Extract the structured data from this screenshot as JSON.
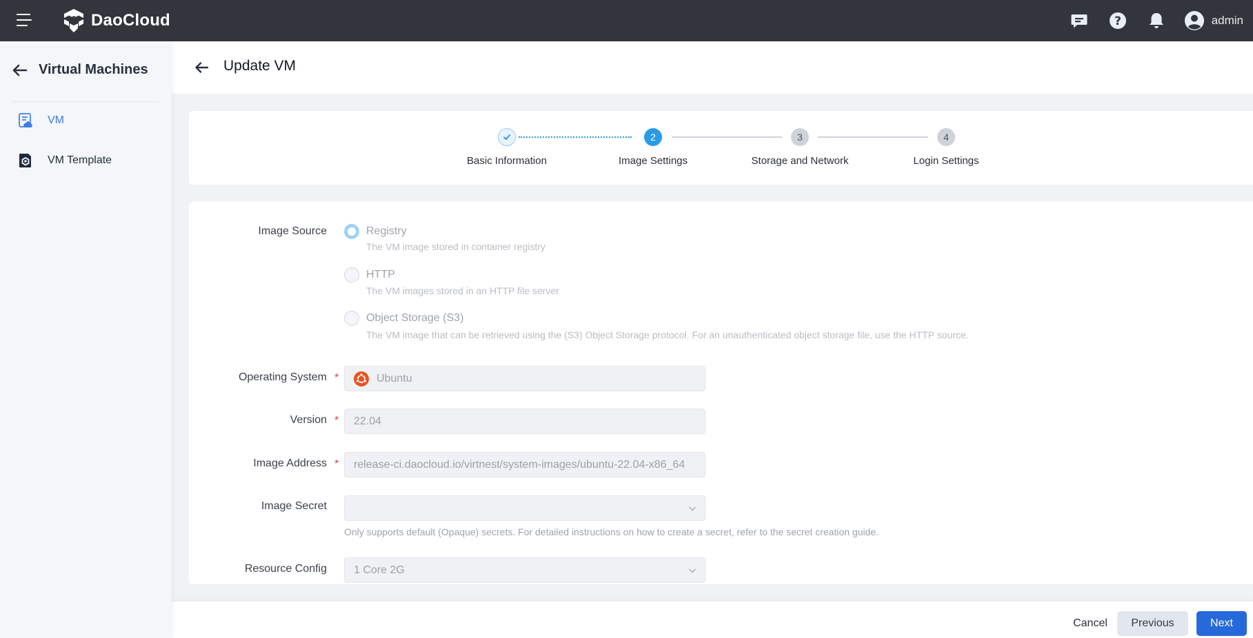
{
  "header": {
    "brand": "DaoCloud",
    "icons": [
      "menu-icon",
      "message-icon",
      "help-icon",
      "bell-icon",
      "user-avatar-icon"
    ],
    "user": "admin"
  },
  "sidebar": {
    "title": "Virtual Machines",
    "items": [
      {
        "label": "VM",
        "icon": "vm-icon",
        "active": true
      },
      {
        "label": "VM Template",
        "icon": "vm-template-icon",
        "active": false
      }
    ]
  },
  "page": {
    "title": "Update VM"
  },
  "stepper": {
    "steps": [
      {
        "label": "Basic Information",
        "number": "1",
        "status": "done"
      },
      {
        "label": "Image Settings",
        "number": "2",
        "status": "current"
      },
      {
        "label": "Storage and Network",
        "number": "3",
        "status": "todo"
      },
      {
        "label": "Login Settings",
        "number": "4",
        "status": "todo"
      }
    ]
  },
  "form": {
    "image_source": {
      "label": "Image Source",
      "selected": "Registry",
      "options": [
        {
          "title": "Registry",
          "desc": "The VM image stored in container registry"
        },
        {
          "title": "HTTP",
          "desc": "The VM images stored in an HTTP file server"
        },
        {
          "title": "Object Storage (S3)",
          "desc": "The VM image that can be retrieved using the (S3) Object Storage protocol. For an unauthenticated object storage file, use the HTTP source."
        }
      ]
    },
    "operating_system": {
      "label": "Operating System",
      "value": "Ubuntu",
      "required": "*"
    },
    "version": {
      "label": "Version",
      "value": "22.04",
      "required": "*"
    },
    "image_address": {
      "label": "Image Address",
      "value": "release-ci.daocloud.io/virtnest/system-images/ubuntu-22.04-x86_64",
      "required": "*"
    },
    "image_secret": {
      "label": "Image Secret",
      "value": "",
      "hint": "Only supports default (Opaque) secrets. For detailed instructions on how to create a secret, refer to the secret creation guide."
    },
    "resource_config": {
      "label": "Resource Config",
      "value": "1 Core 2G"
    }
  },
  "footer": {
    "cancel": "Cancel",
    "previous": "Previous",
    "next": "Next"
  },
  "colors": {
    "header_bg": "#32353b",
    "accent": "#2a9be6",
    "primary_button": "#2669db",
    "ubuntu_orange": "#e95420",
    "required": "#e5393b"
  }
}
